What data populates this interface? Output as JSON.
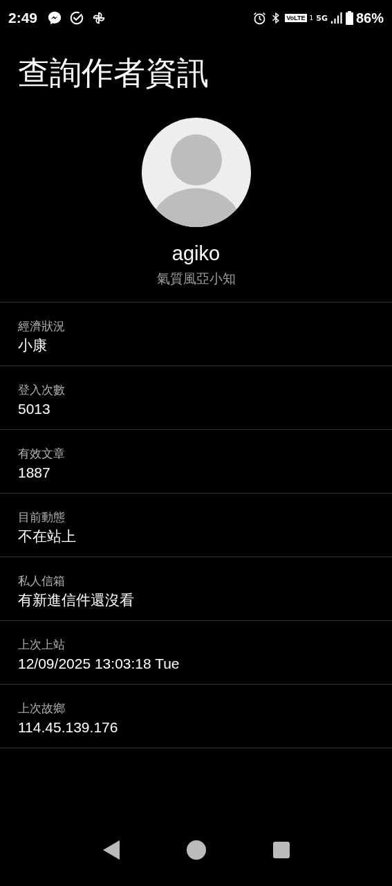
{
  "status_bar": {
    "time": "2:49",
    "volte": "VoLTE",
    "sim": "1",
    "network": "5G",
    "battery": "86%"
  },
  "title": "查詢作者資訊",
  "profile": {
    "username": "agiko",
    "nickname": "氣質風亞小知"
  },
  "fields": [
    {
      "label": "經濟狀況",
      "value": "小康"
    },
    {
      "label": "登入次數",
      "value": "5013"
    },
    {
      "label": "有效文章",
      "value": "1887"
    },
    {
      "label": "目前動態",
      "value": "不在站上"
    },
    {
      "label": "私人信箱",
      "value": "有新進信件還沒看"
    },
    {
      "label": "上次上站",
      "value": "12/09/2025 13:03:18 Tue"
    },
    {
      "label": "上次故鄉",
      "value": "114.45.139.176"
    }
  ]
}
